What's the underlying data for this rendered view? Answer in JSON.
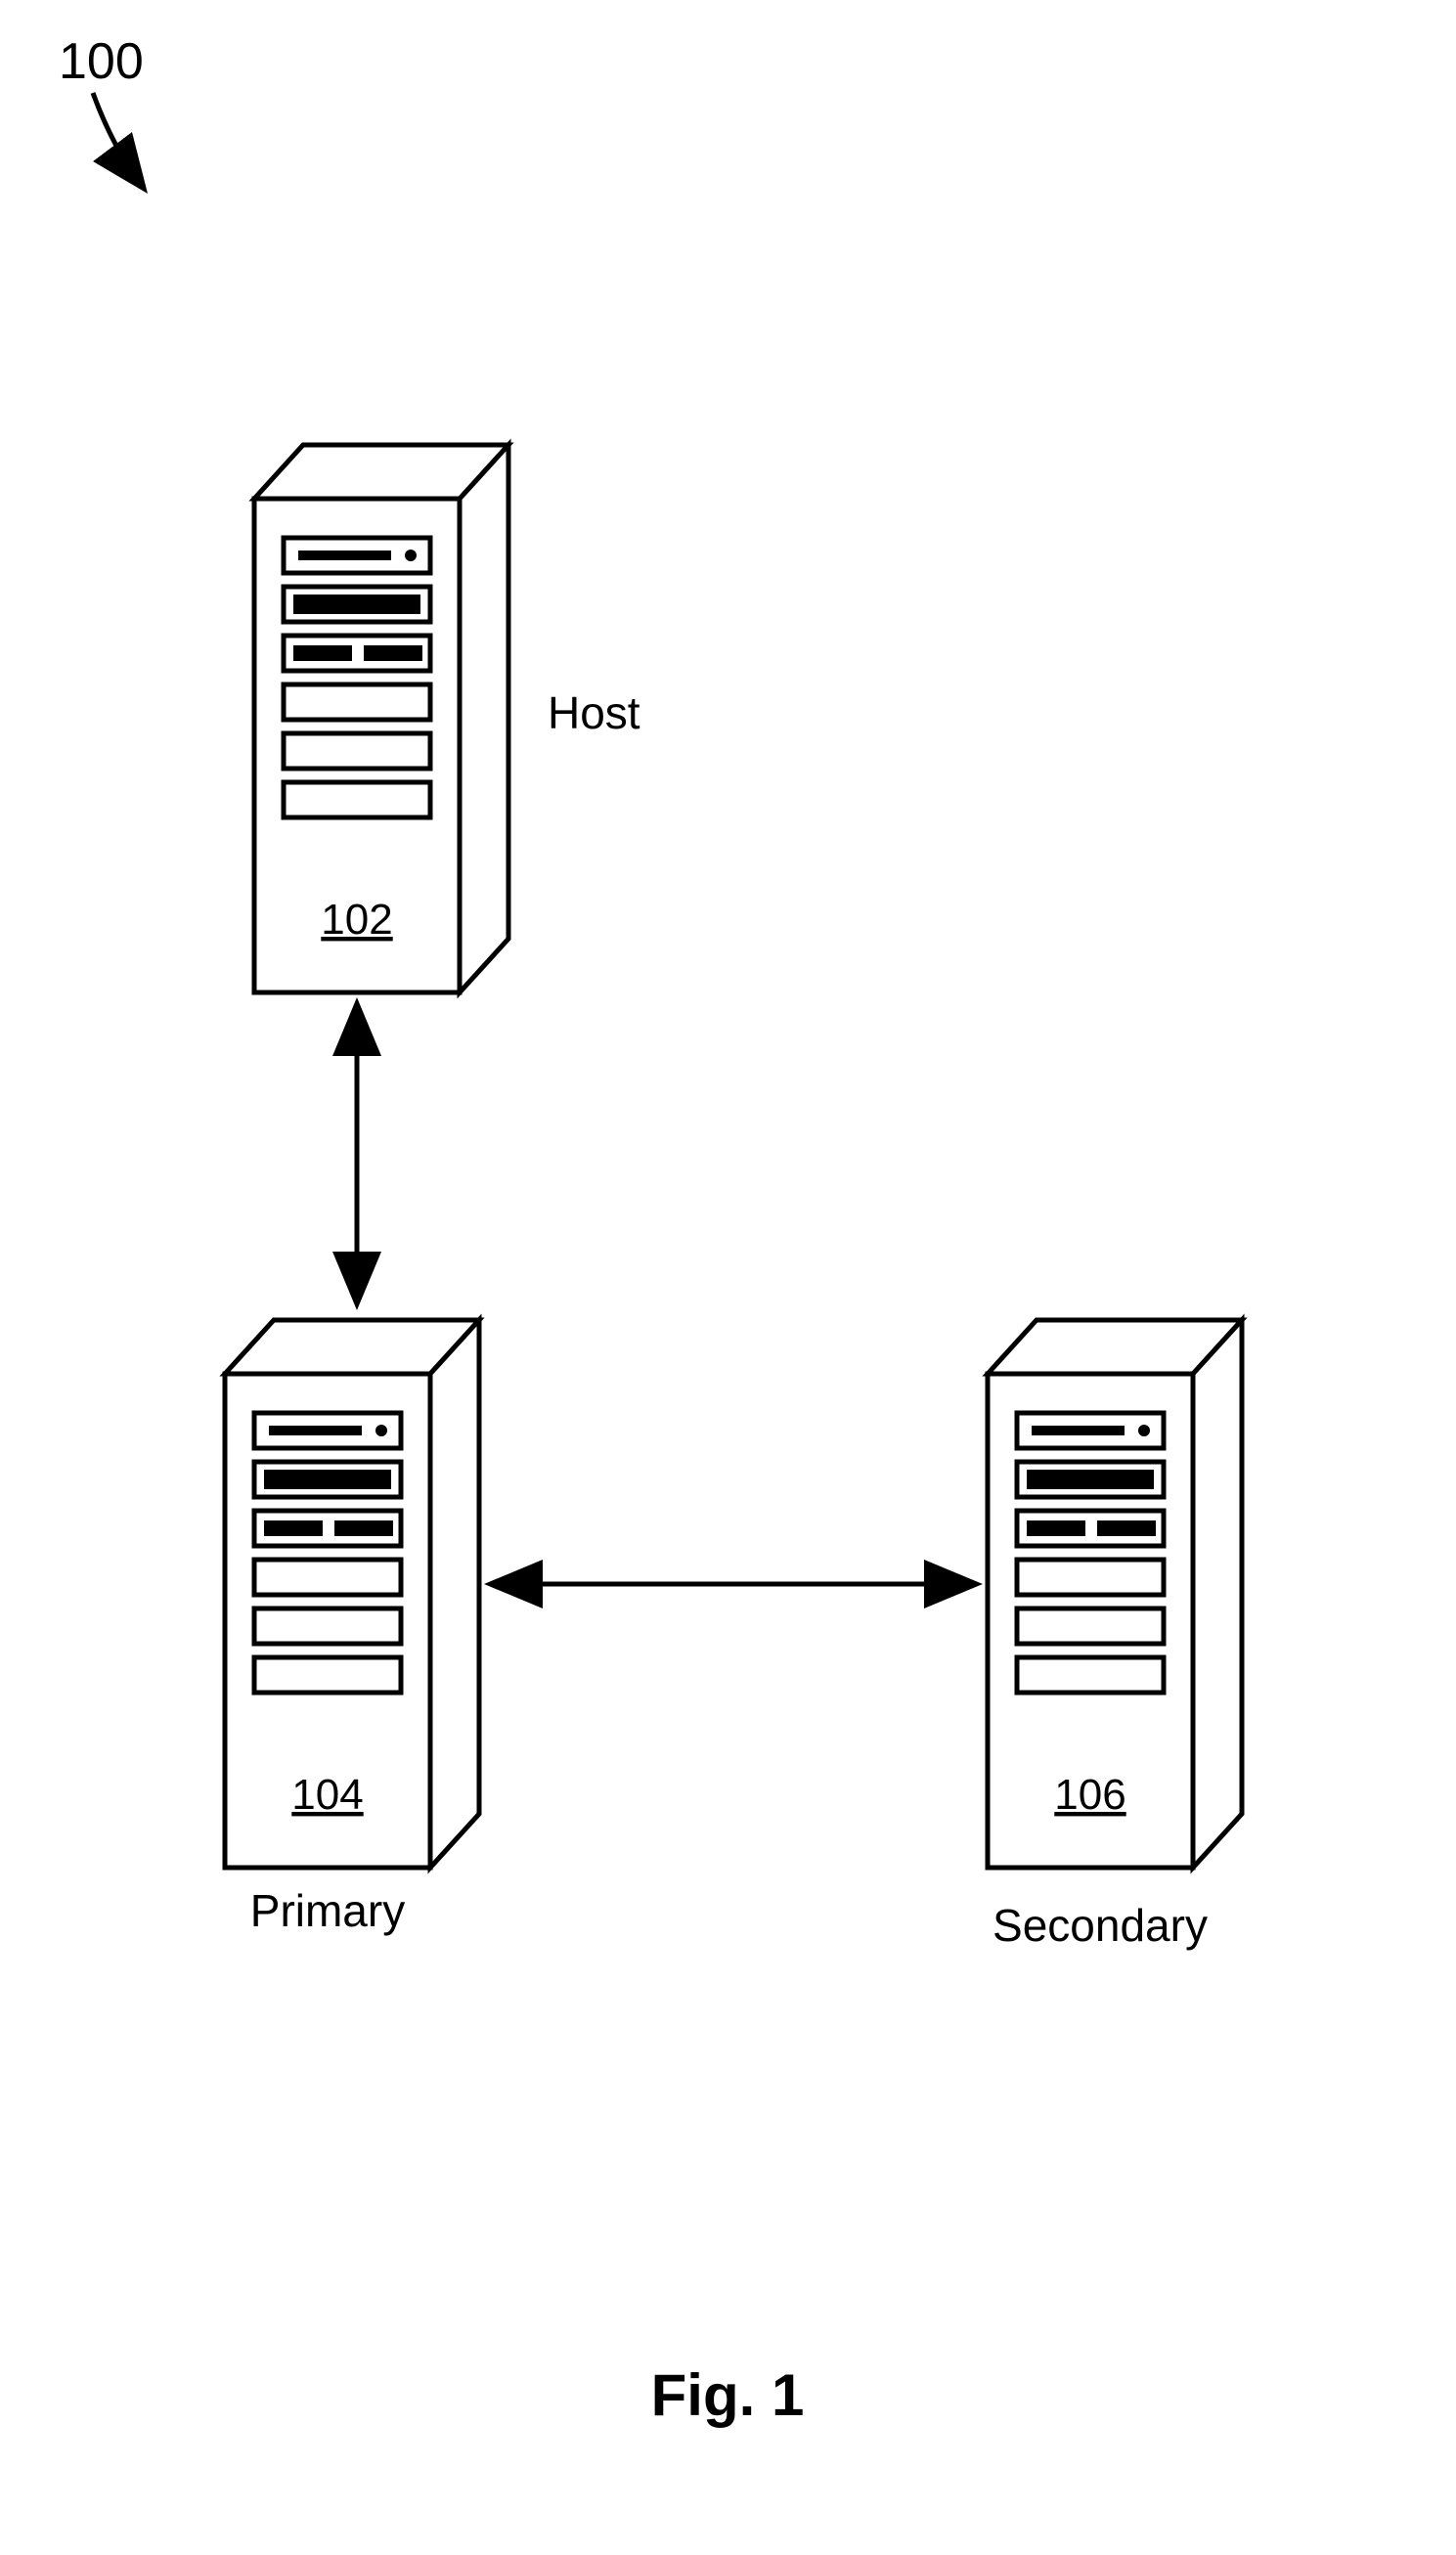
{
  "figure_ref": "100",
  "figure_label": "Fig. 1",
  "nodes": {
    "host": {
      "label": "Host",
      "ref": "102"
    },
    "primary": {
      "label": "Primary",
      "ref": "104"
    },
    "secondary": {
      "label": "Secondary",
      "ref": "106"
    }
  }
}
